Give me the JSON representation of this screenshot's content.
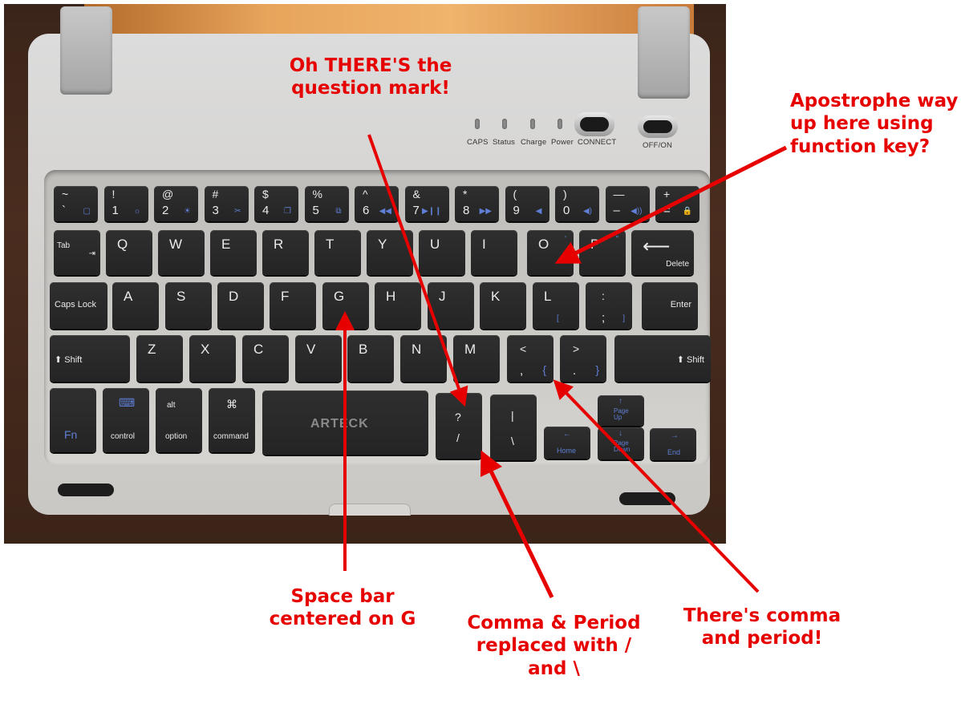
{
  "image": {
    "description": "Annotated photo of a compact Arteck Bluetooth keyboard case with red callouts",
    "brand_label": "ARTECK",
    "accent_color": "#e60000",
    "key_legend_blue": "#5f7fd6"
  },
  "indicators": {
    "leds": [
      "CAPS",
      "Status",
      "Charge",
      "Power"
    ],
    "connect_label": "CONNECT",
    "power_switch_label": "OFF/ON"
  },
  "keyboard": {
    "row1": [
      {
        "top": "~",
        "bottom": "`",
        "fn": "home-square-icon"
      },
      {
        "top": "!",
        "bottom": "1",
        "fn": "brightness-down-icon"
      },
      {
        "top": "@",
        "bottom": "2",
        "fn": "brightness-up-icon"
      },
      {
        "top": "#",
        "bottom": "3",
        "fn": "cut-icon"
      },
      {
        "top": "$",
        "bottom": "4",
        "fn": "copy-icon"
      },
      {
        "top": "%",
        "bottom": "5",
        "fn": "paste-icon"
      },
      {
        "top": "^",
        "bottom": "6",
        "fn": "rewind-icon"
      },
      {
        "top": "&",
        "bottom": "7",
        "fn": "play-pause-icon"
      },
      {
        "top": "*",
        "bottom": "8",
        "fn": "fast-forward-icon"
      },
      {
        "top": "(",
        "bottom": "9",
        "fn": "mute-icon"
      },
      {
        "top": ")",
        "bottom": "0",
        "fn": "volume-down-icon"
      },
      {
        "top": "—",
        "bottom": "–",
        "fn": "volume-up-icon"
      },
      {
        "top": "+",
        "bottom": "=",
        "fn": "lock-icon"
      }
    ],
    "row1_fn_glyphs": [
      "▢",
      "☼",
      "☀",
      "✂",
      "❐",
      "⧉",
      "◀◀",
      "▶❙❙",
      "▶▶",
      "◀",
      "◀)",
      "◀))",
      "🔒"
    ],
    "row2": [
      "Tab",
      "Q",
      "W",
      "E",
      "R",
      "T",
      "Y",
      "U",
      "I",
      "O",
      "P",
      "Delete"
    ],
    "row2_fn": {
      "O": "'",
      "P": "\""
    },
    "row3": [
      "Caps Lock",
      "A",
      "S",
      "D",
      "F",
      "G",
      "H",
      "J",
      "K",
      "L",
      ":",
      "Enter"
    ],
    "row3_extra": {
      "L_fn": "[",
      "semicolon_bottom": ";",
      "semicolon_fn": "]"
    },
    "row4": [
      "Shift",
      "Z",
      "X",
      "C",
      "V",
      "B",
      "N",
      "M",
      "<",
      ">",
      "Shift"
    ],
    "row4_extra": {
      "comma_bottom": ",",
      "comma_fn": "{",
      "period_bottom": ".",
      "period_fn": "}"
    },
    "row5": {
      "fn": "Fn",
      "control": "control",
      "alt_top": "alt",
      "option": "option",
      "cmd_top": "⌘",
      "command": "command",
      "question_top": "?",
      "question_bottom": "/",
      "pipe_top": "|",
      "pipe_bottom": "\\",
      "home": "Home",
      "page_up": "Page Up",
      "page_down": "Page Down",
      "end": "End",
      "arrow_left": "←",
      "arrow_up": "↑",
      "arrow_down": "↓",
      "arrow_right": "→"
    }
  },
  "annotations": [
    {
      "id": "question-mark",
      "text": "Oh THERE'S the question mark!"
    },
    {
      "id": "apostrophe",
      "text": "Apostrophe way up here using function key?"
    },
    {
      "id": "space-bar",
      "text": "Space bar centered on G"
    },
    {
      "id": "slash-keys",
      "text": "Comma & Period replaced with / and \\"
    },
    {
      "id": "comma-period",
      "text": "There's comma and period!"
    }
  ]
}
